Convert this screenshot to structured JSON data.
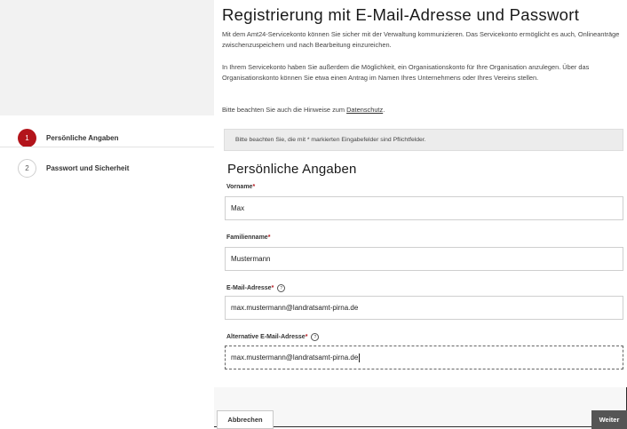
{
  "header": {
    "title": "Registrierung mit E-Mail-Adresse und Passwort",
    "intro_1": "Mit dem Amt24-Servicekonto können Sie sicher mit der Verwaltung kommunizieren. Das Servicekonto ermöglicht es auch, Onlineanträge zwischenzuspeichern und nach Bearbeitung einzureichen.",
    "intro_2": "In Ihrem Servicekonto haben Sie außerdem die Möglichkeit, ein Organisationskonto für Ihre Organisation anzulegen. Über das Organisationskonto können Sie etwa einen Antrag im Namen Ihres Unternehmens oder Ihres Vereins stellen.",
    "intro_3_prefix": "Bitte beachten Sie auch die Hinweise zum ",
    "intro_3_link": "Datenschutz",
    "intro_3_suffix": "."
  },
  "steps": [
    {
      "number": "1",
      "label": "Persönliche Angaben",
      "active": true
    },
    {
      "number": "2",
      "label": "Passwort und Sicherheit",
      "active": false
    }
  ],
  "notice": "Bitte beachten Sie, die mit * markierten Eingabefelder sind Pflichtfelder.",
  "section_title": "Persönliche Angaben",
  "fields": {
    "vorname": {
      "label": "Vorname",
      "required_mark": "*",
      "value": "Max"
    },
    "familienname": {
      "label": "Familienname",
      "required_mark": "*",
      "value": "Mustermann"
    },
    "email": {
      "label": "E-Mail-Adresse",
      "required_mark": "*",
      "value": "max.mustermann@landratsamt-pirna.de",
      "help_icon": "question-circle-icon"
    },
    "alt_email": {
      "label": "Alternative E-Mail-Adresse",
      "required_mark": "*",
      "value": "max.mustermann@landratsamt-pirna.de",
      "help_icon": "question-circle-icon"
    }
  },
  "buttons": {
    "cancel": "Abbrechen",
    "next": "Weiter"
  },
  "colors": {
    "accent": "#b3141b",
    "next_button": "#555555"
  }
}
